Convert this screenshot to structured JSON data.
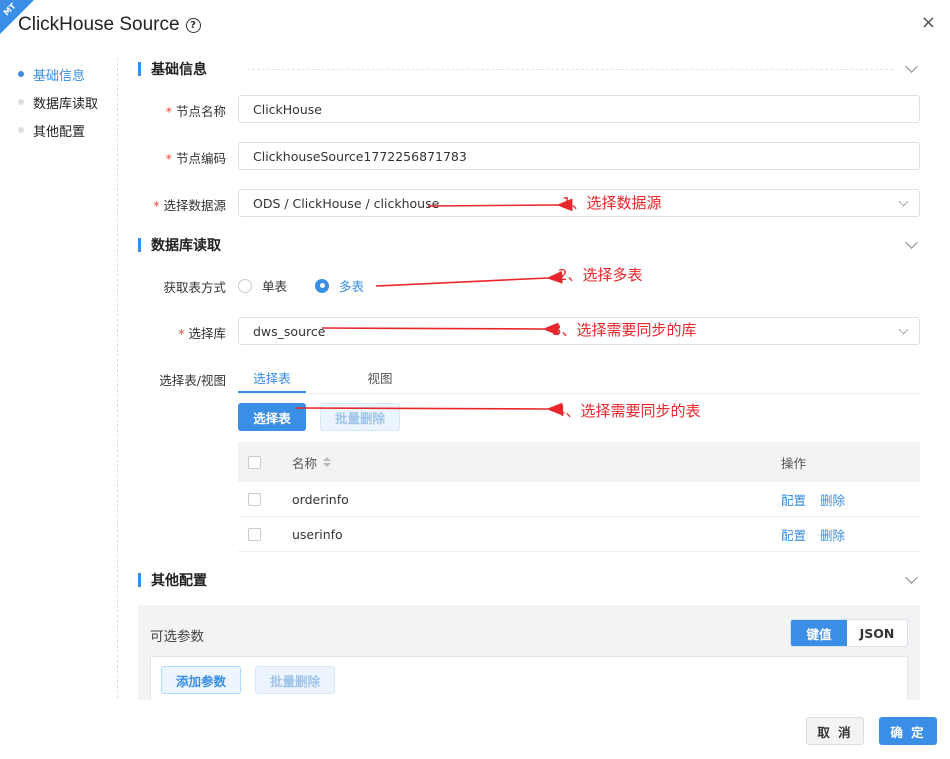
{
  "badge": "MT",
  "dialog": {
    "title": "ClickHouse Source",
    "help_glyph": "?",
    "close_glyph": "×"
  },
  "nav": [
    {
      "label": "基础信息",
      "active": true
    },
    {
      "label": "数据库读取",
      "active": false
    },
    {
      "label": "其他配置",
      "active": false
    }
  ],
  "sections": {
    "basic": "基础信息",
    "db_read": "数据库读取",
    "other": "其他配置"
  },
  "form": {
    "node_name": {
      "label": "节点名称",
      "value": "ClickHouse"
    },
    "node_code": {
      "label": "节点编码",
      "value": "ClickhouseSource1772256871783"
    },
    "datasource": {
      "label": "选择数据源",
      "value": "ODS / ClickHouse / clickhouse"
    },
    "fetch_mode": {
      "label": "获取表方式",
      "options": [
        "单表",
        "多表"
      ],
      "selected": "多表"
    },
    "database": {
      "label": "选择库",
      "value": "dws_source"
    },
    "table_view": {
      "label": "选择表/视图"
    }
  },
  "tabs": [
    "选择表",
    "视图"
  ],
  "buttons": {
    "select_table": "选择表",
    "batch_delete": "批量删除"
  },
  "table": {
    "headers": {
      "name": "名称",
      "ops": "操作"
    },
    "rows": [
      {
        "name": "orderinfo",
        "ops": [
          "配置",
          "删除"
        ]
      },
      {
        "name": "userinfo",
        "ops": [
          "配置",
          "删除"
        ]
      }
    ]
  },
  "params": {
    "title": "可选参数",
    "modes": [
      "键值",
      "JSON"
    ],
    "active_mode": "键值",
    "add_label": "添加参数",
    "batch_delete": "批量删除"
  },
  "footer": {
    "cancel": "取 消",
    "ok": "确 定"
  },
  "annotations": {
    "color": "#e8262b",
    "items": [
      "1、选择数据源",
      "2、选择多表",
      "3、选择需要同步的库",
      "4、选择需要同步的表"
    ]
  }
}
